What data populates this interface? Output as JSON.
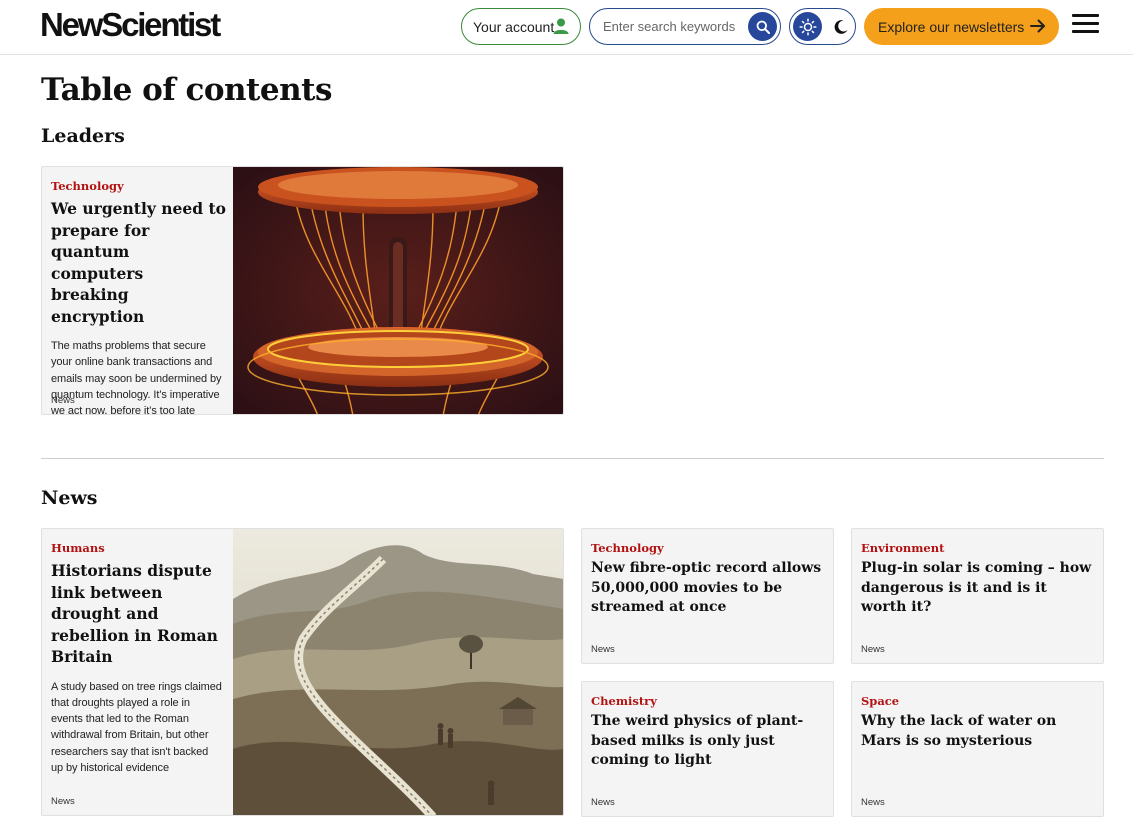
{
  "header": {
    "logo": "NewScientist",
    "account_label": "Your account",
    "search_placeholder": "Enter search keywords",
    "newsletter_label": "Explore our newsletters"
  },
  "page_title": "Table of contents",
  "sections": {
    "leaders": {
      "title": "Leaders",
      "cards": [
        {
          "category": "Technology",
          "headline": "We urgently need to prepare for quantum computers breaking encryption",
          "summary": "The maths problems that secure your online bank transactions and emails may soon be undermined by quantum technology. It’s imperative we act now, before it’s too late",
          "tag": "News"
        }
      ]
    },
    "news": {
      "title": "News",
      "cards": [
        {
          "category": "Humans",
          "headline": "Historians dispute link between drought and rebellion in Roman Britain",
          "summary": "A study based on tree rings claimed that droughts played a role in events that led to the Roman withdrawal from Britain, but other researchers say that isn't backed up by historical evidence",
          "tag": "News"
        },
        {
          "category": "Technology",
          "headline": "New fibre-optic record allows 50,000,000 movies to be streamed at once",
          "tag": "News"
        },
        {
          "category": "Environment",
          "headline": "Plug-in solar is coming – how dangerous is it and is it worth it?",
          "tag": "News"
        },
        {
          "category": "Chemistry",
          "headline": "The weird physics of plant-based milks is only just coming to light",
          "tag": "News"
        },
        {
          "category": "Space",
          "headline": "Why the lack of water on Mars is so mysterious",
          "tag": "News"
        }
      ]
    }
  },
  "colors": {
    "accent_green": "#3a8a3a",
    "accent_blue": "#26479a",
    "accent_orange": "#f5a01a",
    "category_red": "#b31212"
  },
  "icons": [
    "user-icon",
    "search-icon",
    "sun-icon",
    "moon-icon",
    "arrow-right-icon",
    "hamburger-menu-icon"
  ]
}
